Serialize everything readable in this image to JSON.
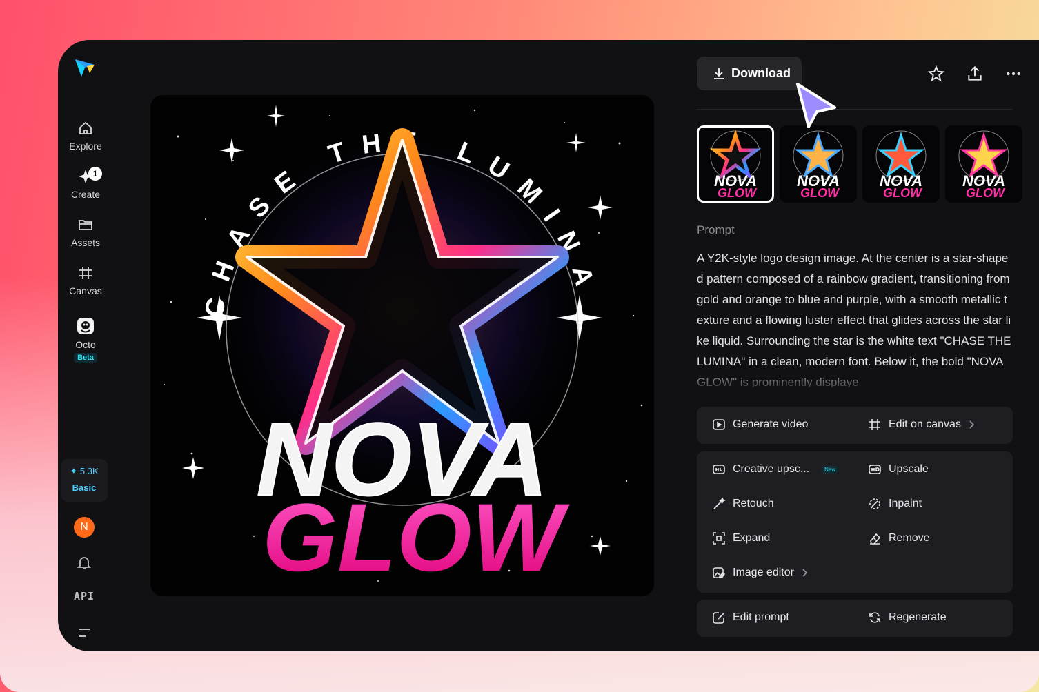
{
  "sidebar": {
    "items": [
      {
        "label": "Explore"
      },
      {
        "label": "Create",
        "badge": "1"
      },
      {
        "label": "Assets"
      },
      {
        "label": "Canvas"
      },
      {
        "label": "Octo",
        "tag": "Beta"
      }
    ],
    "credits": {
      "amount": "5.3K",
      "plan": "Basic"
    },
    "avatar_initial": "N",
    "api_label": "API"
  },
  "artwork": {
    "arc_text": "CHASE THE LUMINA",
    "title_line1": "NOVA",
    "title_line2": "GLOW"
  },
  "panel": {
    "download_label": "Download",
    "prompt_label": "Prompt",
    "prompt_text": "A Y2K-style logo design image. At the center is a star-shaped pattern composed of a rainbow gradient, transitioning from gold and orange to blue and purple, with a smooth metallic texture and a flowing luster effect that glides across the star like liquid. Surrounding the star is the white text \"CHASE THE LUMINA\" in a clean, modern font. Below it, the bold \"NOVA GLOW\" is prominently displaye",
    "thumbnails": [
      {
        "line1": "NOVA",
        "line2": "GLOW"
      },
      {
        "line1": "NOVA",
        "line2": "GLOW"
      },
      {
        "line1": "NOVA",
        "line2": "GLOW"
      },
      {
        "line1": "NOVA",
        "line2": "GLOW"
      }
    ],
    "actions_top": {
      "generate_video": "Generate video",
      "edit_on_canvas": "Edit on canvas"
    },
    "actions_tools": {
      "creative_upscale": "Creative upsc...",
      "new_tag": "New",
      "upscale": "Upscale",
      "retouch": "Retouch",
      "inpaint": "Inpaint",
      "expand": "Expand",
      "remove": "Remove",
      "image_editor": "Image editor"
    },
    "actions_bottom": {
      "edit_prompt": "Edit prompt",
      "regenerate": "Regenerate"
    }
  },
  "colors": {
    "accent": "#4fd4ff",
    "panel_bg": "#111114",
    "card_bg": "#1d1d22",
    "pink": "#ff2fa6"
  }
}
